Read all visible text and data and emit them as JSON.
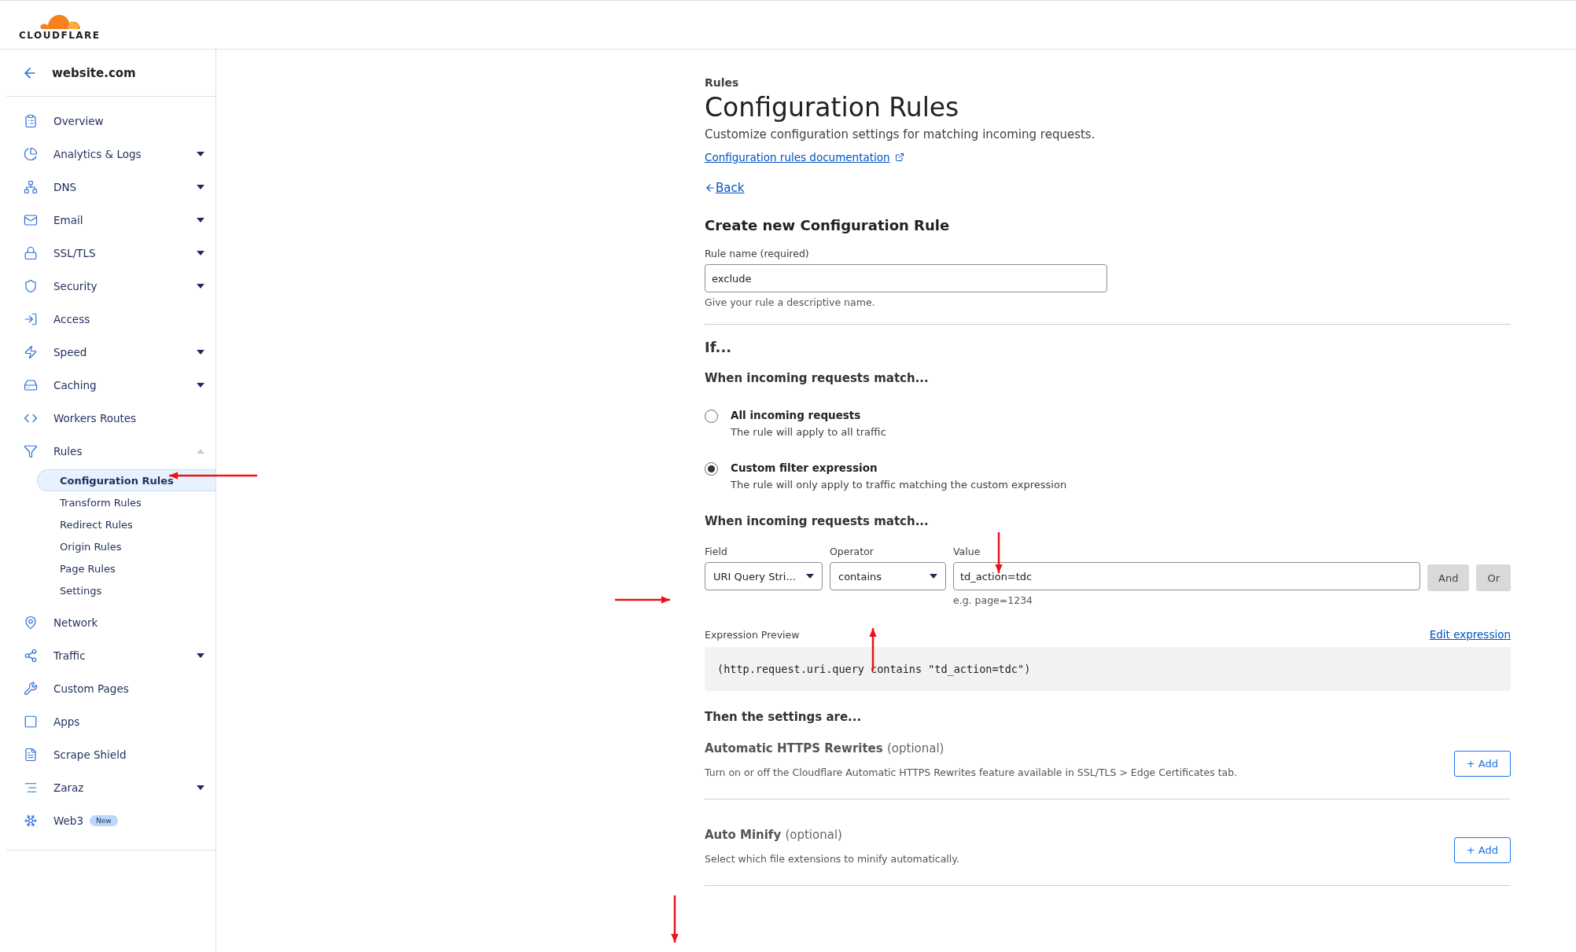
{
  "header": {
    "logo_text": "CLOUDFLARE"
  },
  "sidebar": {
    "site": "website.com",
    "items": [
      {
        "label": "Overview",
        "kind": "link"
      },
      {
        "label": "Analytics & Logs",
        "kind": "group",
        "expanded": false
      },
      {
        "label": "DNS",
        "kind": "group",
        "expanded": false
      },
      {
        "label": "Email",
        "kind": "group",
        "expanded": false
      },
      {
        "label": "SSL/TLS",
        "kind": "group",
        "expanded": false
      },
      {
        "label": "Security",
        "kind": "group",
        "expanded": false
      },
      {
        "label": "Access",
        "kind": "link"
      },
      {
        "label": "Speed",
        "kind": "group",
        "expanded": false
      },
      {
        "label": "Caching",
        "kind": "group",
        "expanded": false
      },
      {
        "label": "Workers Routes",
        "kind": "link"
      },
      {
        "label": "Rules",
        "kind": "group",
        "expanded": true,
        "children": [
          {
            "label": "Configuration Rules",
            "selected": true
          },
          {
            "label": "Transform Rules",
            "selected": false
          },
          {
            "label": "Redirect Rules",
            "selected": false
          },
          {
            "label": "Origin Rules",
            "selected": false
          },
          {
            "label": "Page Rules",
            "selected": false
          },
          {
            "label": "Settings",
            "selected": false
          }
        ]
      },
      {
        "label": "Network",
        "kind": "link"
      },
      {
        "label": "Traffic",
        "kind": "group",
        "expanded": false
      },
      {
        "label": "Custom Pages",
        "kind": "link"
      },
      {
        "label": "Apps",
        "kind": "link"
      },
      {
        "label": "Scrape Shield",
        "kind": "link"
      },
      {
        "label": "Zaraz",
        "kind": "group",
        "expanded": false
      },
      {
        "label": "Web3",
        "kind": "link",
        "badge": "New"
      }
    ]
  },
  "page": {
    "eyebrow": "Rules",
    "title": "Configuration Rules",
    "subtitle": "Customize configuration settings for matching incoming requests.",
    "doc_link": "Configuration rules documentation",
    "back": "Back",
    "form_title": "Create new Configuration Rule",
    "rule_name": {
      "label": "Rule name (required)",
      "value": "exclude",
      "hint": "Give your rule a descriptive name."
    },
    "if_heading": "If...",
    "match_heading": "When incoming requests match...",
    "options": [
      {
        "title": "All incoming requests",
        "description": "The rule will apply to all traffic",
        "selected": false
      },
      {
        "title": "Custom filter expression",
        "description": "The rule will only apply to traffic matching the custom expression",
        "selected": true
      }
    ],
    "expression_heading": "When incoming requests match...",
    "field": {
      "label": "Field",
      "value": "URI Query Stri..."
    },
    "operator": {
      "label": "Operator",
      "value": "contains"
    },
    "value": {
      "label": "Value",
      "value": "td_action=tdc",
      "hint": "e.g. page=1234"
    },
    "logic_buttons": [
      "And",
      "Or"
    ],
    "preview": {
      "label": "Expression Preview",
      "edit_link": "Edit expression",
      "expression": "(http.request.uri.query contains \"td_action=tdc\")"
    },
    "settings_heading": "Then the settings are...",
    "settings": [
      {
        "name": "Automatic HTTPS Rewrites",
        "optional": "(optional)",
        "description": "Turn on or off the Cloudflare Automatic HTTPS Rewrites feature available in SSL/TLS > Edge Certificates tab.",
        "button": "+ Add"
      },
      {
        "name": "Auto Minify",
        "optional": "(optional)",
        "description": "Select which file extensions to minify automatically.",
        "button": "+ Add"
      }
    ]
  }
}
